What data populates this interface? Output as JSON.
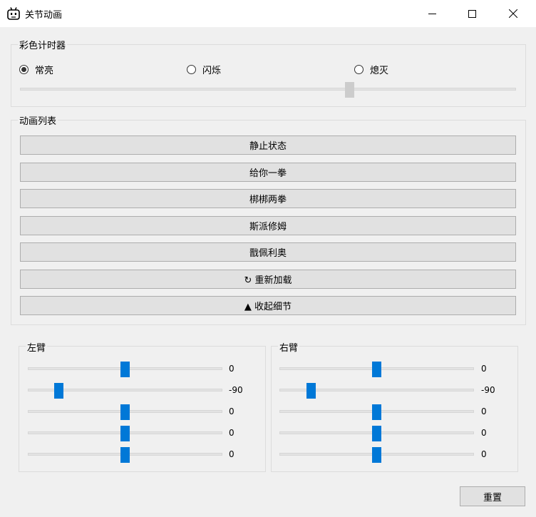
{
  "window": {
    "title": "关节动画"
  },
  "timer_group": {
    "title": "彩色计时器",
    "options": [
      {
        "label": "常亮",
        "selected": true
      },
      {
        "label": "闪烁",
        "selected": false
      },
      {
        "label": "熄灭",
        "selected": false
      }
    ],
    "slider_fraction": 0.66
  },
  "anim_group": {
    "title": "动画列表",
    "buttons": [
      "静止状态",
      "给你一拳",
      "梆梆两拳",
      "斯派修姆",
      "戬佩利奥",
      "↻ 重新加载",
      "▲ 收起细节"
    ]
  },
  "left_arm": {
    "title": "左臂",
    "values": [
      "0",
      "-90",
      "0",
      "0",
      "0"
    ]
  },
  "right_arm": {
    "title": "右臂",
    "values": [
      "0",
      "-90",
      "0",
      "0",
      "0"
    ]
  },
  "reset_label": "重置",
  "colors": {
    "accent": "#0078d7",
    "slider_thumb_disabled": "#cccccc"
  }
}
